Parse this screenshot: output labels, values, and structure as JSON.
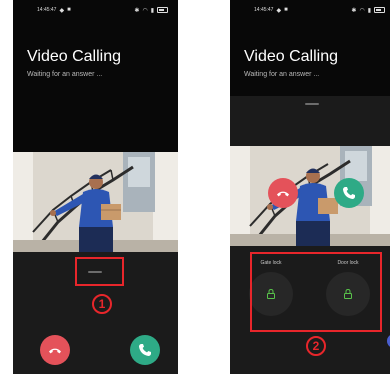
{
  "screens": [
    {
      "status": {
        "time": "14:45:47"
      },
      "title": "Video Calling",
      "subtitle": "Waiting for an answer ...",
      "marker": "1"
    },
    {
      "status": {
        "time": "14:45:47"
      },
      "title": "Video Calling",
      "subtitle": "Waiting for an answer ...",
      "locks": [
        {
          "label": "Gate lock"
        },
        {
          "label": "Door lock"
        }
      ],
      "marker": "2"
    }
  ],
  "colors": {
    "decline": "#e4525a",
    "answer": "#2eaa86",
    "lock_icon": "#58c24a",
    "annotation": "#e8262b"
  },
  "icons": {
    "decline": "phone-hangup-icon",
    "answer": "phone-answer-icon",
    "lock": "padlock-icon"
  }
}
